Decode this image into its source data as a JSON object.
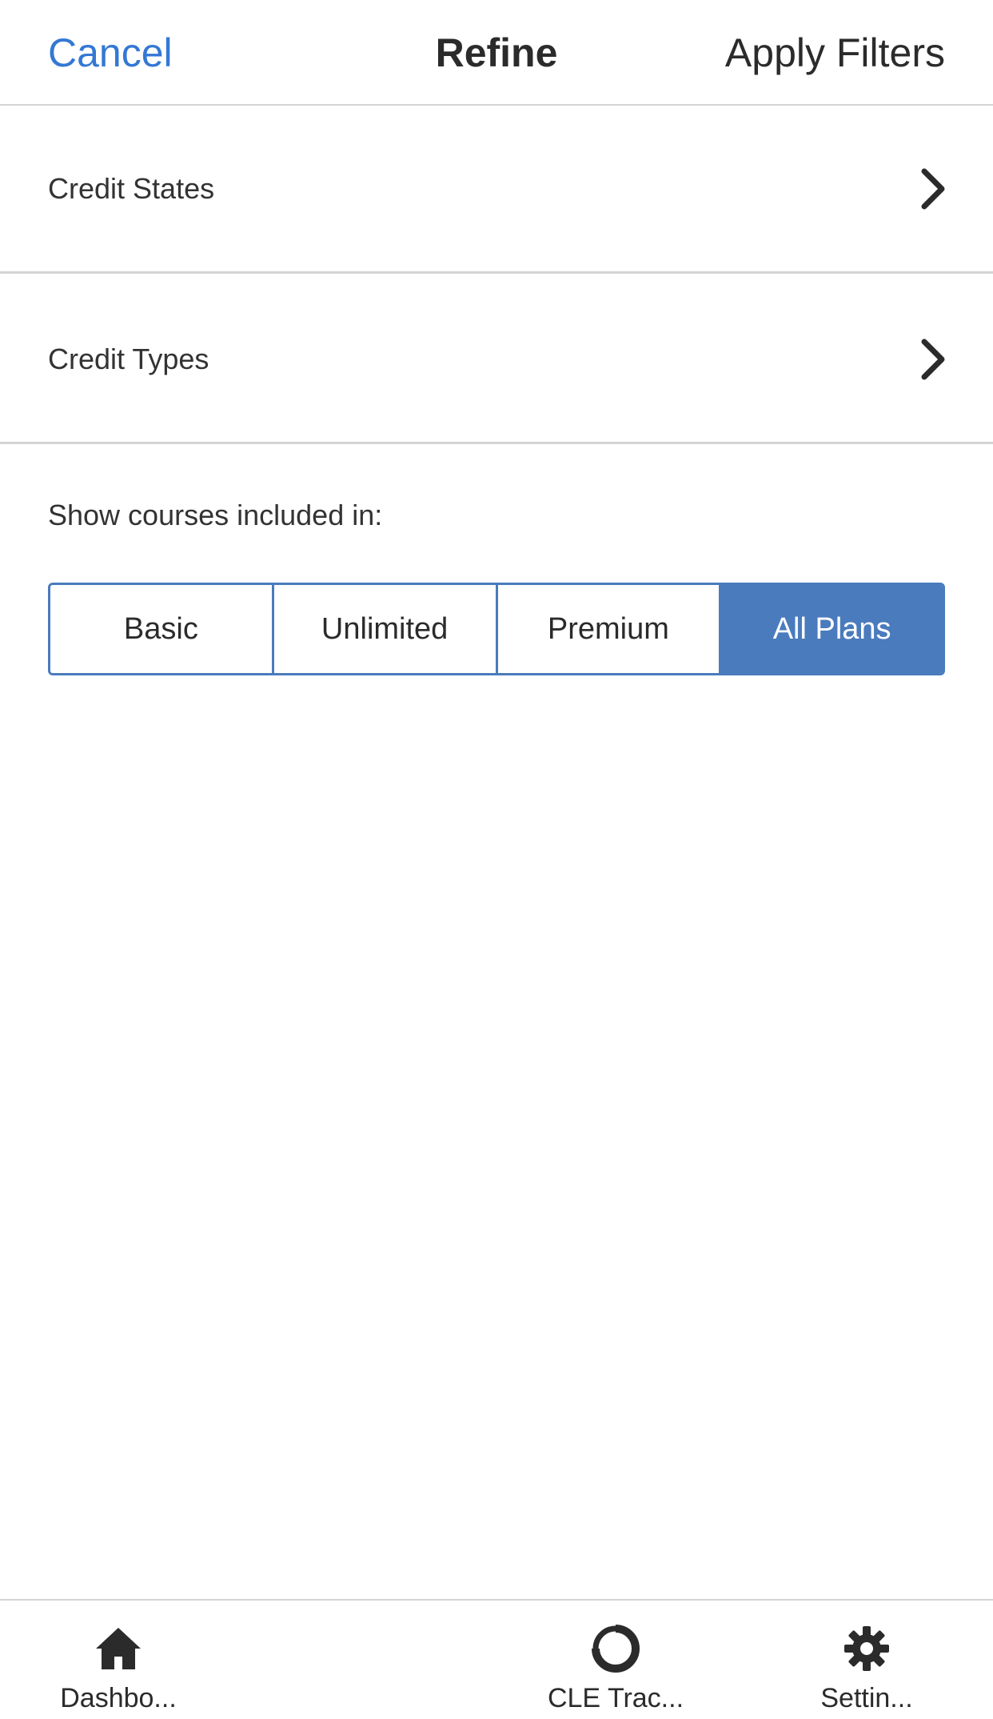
{
  "nav": {
    "cancel": "Cancel",
    "title": "Refine",
    "apply": "Apply Filters"
  },
  "rows": [
    {
      "label": "Credit States",
      "icon": "chevron-right-icon"
    },
    {
      "label": "Credit Types",
      "icon": "chevron-right-icon"
    }
  ],
  "plans": {
    "label": "Show courses included in:",
    "options": [
      "Basic",
      "Unlimited",
      "Premium",
      "All Plans"
    ],
    "selected": "All Plans"
  },
  "tab_bar": {
    "items": [
      {
        "label": "Dashbo...",
        "icon": "home-icon"
      },
      {
        "label": "CLE Trac...",
        "icon": "progress-ring-icon"
      },
      {
        "label": "Settin...",
        "icon": "gear-icon"
      }
    ]
  },
  "colors": {
    "accent": "#3478d4",
    "segment_selected": "#4a7bbd",
    "text": "#2b2b2b",
    "divider": "#d4d4d4"
  }
}
